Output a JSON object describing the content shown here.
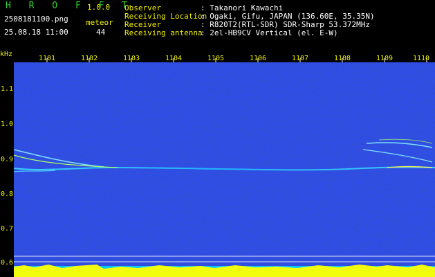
{
  "header": {
    "brand": "H R O F F T",
    "version": "1.0.0",
    "filename": "2508181100.png",
    "datetime": "25.08.18 11:00",
    "meteor_label": "meteor",
    "meteor_count": "44"
  },
  "info": [
    {
      "label": "Observer",
      "value": ": Takanori Kawachi"
    },
    {
      "label": "Receiving Location",
      "value": ": Ogaki, Gifu, JAPAN (136.60E, 35.35N)"
    },
    {
      "label": "Receiver",
      "value": ": R820T2(RTL-SDR) SDR-Sharp 53.372MHz"
    },
    {
      "label": "Receiving antenna",
      "value": ": 2el-HB9CV Vertical (el. E-W)"
    }
  ],
  "axis": {
    "y_unit": "kHz",
    "y_ticks": [
      "1.1",
      "1.0",
      "0.9",
      "0.8",
      "0.7",
      "0.6"
    ],
    "x_ticks": [
      "1101",
      "1102",
      "1103",
      "1104",
      "1105",
      "1106",
      "1107",
      "1108",
      "1109",
      "1110"
    ]
  },
  "colors": {
    "background": "#000000",
    "spectrum": "#0a1a8c",
    "trace": "#28c8ff",
    "meteor": "#aaff44",
    "baseline": "#ffff00",
    "grid": "#ffffff",
    "noise_band": "#00c8ff"
  }
}
